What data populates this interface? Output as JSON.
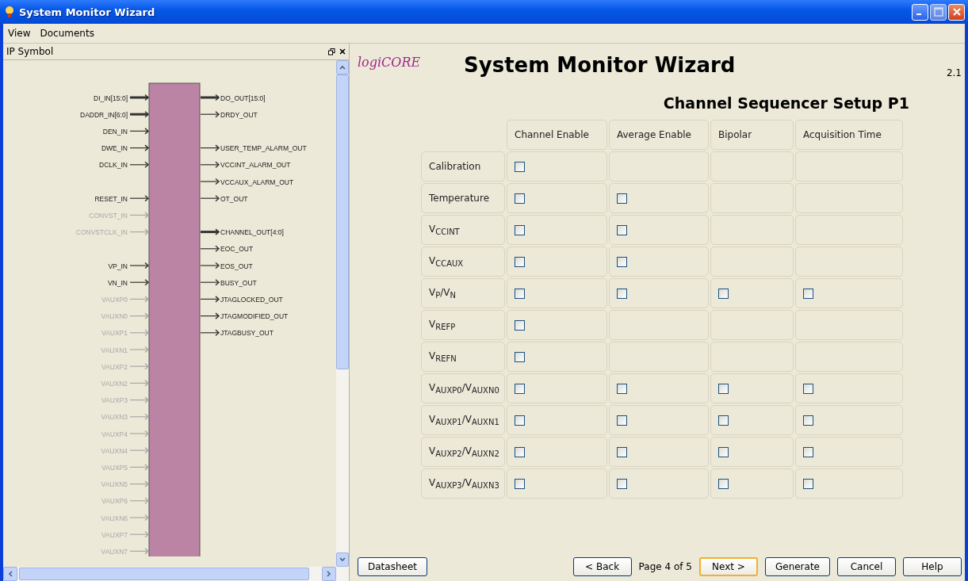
{
  "window": {
    "title": "System Monitor Wizard"
  },
  "menu": [
    "View",
    "Documents"
  ],
  "ip_symbol": {
    "title": "IP Symbol",
    "rows": [
      {
        "input": {
          "name": "DI_IN[15:0]",
          "bus": true,
          "disabled": false
        },
        "output": {
          "name": "DO_OUT[15:0]",
          "bus": true,
          "disabled": false
        }
      },
      {
        "input": {
          "name": "DADDR_IN[6:0]",
          "bus": true,
          "disabled": false
        },
        "output": {
          "name": "DRDY_OUT",
          "bus": false,
          "disabled": false
        }
      },
      {
        "input": {
          "name": "DEN_IN",
          "bus": false,
          "disabled": false
        }
      },
      {
        "input": {
          "name": "DWE_IN",
          "bus": false,
          "disabled": false
        },
        "output": {
          "name": "USER_TEMP_ALARM_OUT",
          "bus": false,
          "disabled": false
        }
      },
      {
        "input": {
          "name": "DCLK_IN",
          "bus": false,
          "disabled": false
        },
        "output": {
          "name": "VCCINT_ALARM_OUT",
          "bus": false,
          "disabled": false
        }
      },
      {
        "output": {
          "name": "VCCAUX_ALARM_OUT",
          "bus": false,
          "disabled": false
        }
      },
      {
        "input": {
          "name": "RESET_IN",
          "bus": false,
          "disabled": false
        },
        "output": {
          "name": "OT_OUT",
          "bus": false,
          "disabled": false
        }
      },
      {
        "input": {
          "name": "CONVST_IN",
          "bus": false,
          "disabled": true
        }
      },
      {
        "input": {
          "name": "CONVSTCLK_IN",
          "bus": false,
          "disabled": true
        },
        "output": {
          "name": "CHANNEL_OUT[4:0]",
          "bus": true,
          "disabled": false
        }
      },
      {
        "output": {
          "name": "EOC_OUT",
          "bus": false,
          "disabled": false
        }
      },
      {
        "input": {
          "name": "VP_IN",
          "bus": false,
          "disabled": false
        },
        "output": {
          "name": "EOS_OUT",
          "bus": false,
          "disabled": false
        }
      },
      {
        "input": {
          "name": "VN_IN",
          "bus": false,
          "disabled": false
        },
        "output": {
          "name": "BUSY_OUT",
          "bus": false,
          "disabled": false
        }
      },
      {
        "input": {
          "name": "VAUXP0",
          "bus": false,
          "disabled": true
        },
        "output": {
          "name": "JTAGLOCKED_OUT",
          "bus": false,
          "disabled": false
        }
      },
      {
        "input": {
          "name": "VAUXN0",
          "bus": false,
          "disabled": true
        },
        "output": {
          "name": "JTAGMODIFIED_OUT",
          "bus": false,
          "disabled": false
        }
      },
      {
        "input": {
          "name": "VAUXP1",
          "bus": false,
          "disabled": true
        },
        "output": {
          "name": "JTAGBUSY_OUT",
          "bus": false,
          "disabled": false
        }
      },
      {
        "input": {
          "name": "VAUXN1",
          "bus": false,
          "disabled": true
        }
      },
      {
        "input": {
          "name": "VAUXP2",
          "bus": false,
          "disabled": true
        }
      },
      {
        "input": {
          "name": "VAUXN2",
          "bus": false,
          "disabled": true
        }
      },
      {
        "input": {
          "name": "VAUXP3",
          "bus": false,
          "disabled": true
        }
      },
      {
        "input": {
          "name": "VAUXN3",
          "bus": false,
          "disabled": true
        }
      },
      {
        "input": {
          "name": "VAUXP4",
          "bus": false,
          "disabled": true
        }
      },
      {
        "input": {
          "name": "VAUXN4",
          "bus": false,
          "disabled": true
        }
      },
      {
        "input": {
          "name": "VAUXP5",
          "bus": false,
          "disabled": true
        }
      },
      {
        "input": {
          "name": "VAUXN5",
          "bus": false,
          "disabled": true
        }
      },
      {
        "input": {
          "name": "VAUXP6",
          "bus": false,
          "disabled": true
        }
      },
      {
        "input": {
          "name": "VAUXN6",
          "bus": false,
          "disabled": true
        }
      },
      {
        "input": {
          "name": "VAUXP7",
          "bus": false,
          "disabled": true
        }
      },
      {
        "input": {
          "name": "VAUXN7",
          "bus": false,
          "disabled": true
        }
      }
    ]
  },
  "logo": "logiCORE",
  "title": "System Monitor Wizard",
  "version": "2.1",
  "subtitle": "Channel Sequencer Setup P1",
  "table": {
    "columns": [
      "Channel Enable",
      "Average Enable",
      "Bipolar",
      "Acquisition Time"
    ],
    "rows": [
      {
        "label": "Calibration",
        "cells": [
          {
            "kind": "checkbox",
            "checked": false
          },
          {
            "kind": "empty"
          },
          {
            "kind": "empty"
          },
          {
            "kind": "empty"
          }
        ]
      },
      {
        "label": "Temperature",
        "cells": [
          {
            "kind": "checkbox",
            "checked": false
          },
          {
            "kind": "checkbox",
            "checked": false
          },
          {
            "kind": "empty"
          },
          {
            "kind": "empty"
          }
        ]
      },
      {
        "label": "V$_{CCINT}$",
        "cells": [
          {
            "kind": "checkbox",
            "checked": false
          },
          {
            "kind": "checkbox",
            "checked": false
          },
          {
            "kind": "empty"
          },
          {
            "kind": "empty"
          }
        ]
      },
      {
        "label": "V$_{CCAUX}$",
        "cells": [
          {
            "kind": "checkbox",
            "checked": false
          },
          {
            "kind": "checkbox",
            "checked": false
          },
          {
            "kind": "empty"
          },
          {
            "kind": "empty"
          }
        ]
      },
      {
        "label": "V$_{P}$/V$_{N}$",
        "cells": [
          {
            "kind": "checkbox",
            "checked": false
          },
          {
            "kind": "checkbox",
            "checked": false
          },
          {
            "kind": "checkbox",
            "checked": false
          },
          {
            "kind": "checkbox",
            "checked": false
          }
        ]
      },
      {
        "label": "V$_{REFP}$",
        "cells": [
          {
            "kind": "checkbox",
            "checked": false
          },
          {
            "kind": "empty"
          },
          {
            "kind": "empty"
          },
          {
            "kind": "empty"
          }
        ]
      },
      {
        "label": "V$_{REFN}$",
        "cells": [
          {
            "kind": "checkbox",
            "checked": false
          },
          {
            "kind": "empty"
          },
          {
            "kind": "empty"
          },
          {
            "kind": "empty"
          }
        ]
      },
      {
        "label": "V$_{AUXP0}$/V$_{AUXN0}$",
        "cells": [
          {
            "kind": "checkbox",
            "checked": false
          },
          {
            "kind": "checkbox",
            "checked": false
          },
          {
            "kind": "checkbox",
            "checked": false
          },
          {
            "kind": "checkbox",
            "checked": false
          }
        ]
      },
      {
        "label": "V$_{AUXP1}$/V$_{AUXN1}$",
        "cells": [
          {
            "kind": "checkbox",
            "checked": false
          },
          {
            "kind": "checkbox",
            "checked": false
          },
          {
            "kind": "checkbox",
            "checked": false
          },
          {
            "kind": "checkbox",
            "checked": false
          }
        ]
      },
      {
        "label": "V$_{AUXP2}$/V$_{AUXN2}$",
        "cells": [
          {
            "kind": "checkbox",
            "checked": false
          },
          {
            "kind": "checkbox",
            "checked": false
          },
          {
            "kind": "checkbox",
            "checked": false
          },
          {
            "kind": "checkbox",
            "checked": false
          }
        ]
      },
      {
        "label": "V$_{AUXP3}$/V$_{AUXN3}$",
        "cells": [
          {
            "kind": "checkbox",
            "checked": false
          },
          {
            "kind": "checkbox",
            "checked": false
          },
          {
            "kind": "checkbox",
            "checked": false
          },
          {
            "kind": "checkbox",
            "checked": false
          }
        ]
      }
    ]
  },
  "datasheet_button": "Datasheet",
  "page_indicator": "Page 4 of 5",
  "buttons": [
    {
      "label": "< Back",
      "focused": false
    },
    {
      "kind": "page"
    },
    {
      "label": "Next >",
      "focused": true
    },
    {
      "label": "Generate",
      "focused": false
    },
    {
      "label": "Cancel",
      "focused": false
    },
    {
      "label": "Help",
      "focused": false
    }
  ]
}
